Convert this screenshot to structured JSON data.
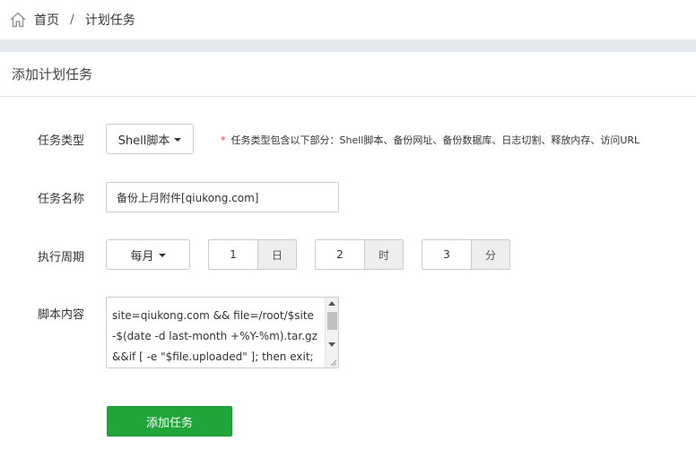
{
  "breadcrumb": {
    "home": "首页",
    "separator": "/",
    "current": "计划任务"
  },
  "panel": {
    "title": "添加计划任务"
  },
  "form": {
    "task_type": {
      "label": "任务类型",
      "selected": "Shell脚本",
      "hint_star": "*",
      "hint": "任务类型包含以下部分：Shell脚本、备份网址、备份数据库、日志切割、释放内存、访问URL"
    },
    "task_name": {
      "label": "任务名称",
      "value": "备份上月附件[qiukong.com]"
    },
    "cycle": {
      "label": "执行周期",
      "period": "每月",
      "day": {
        "value": "1",
        "unit": "日"
      },
      "hour": {
        "value": "2",
        "unit": "时"
      },
      "minute": {
        "value": "3",
        "unit": "分"
      }
    },
    "script": {
      "label": "脚本内容",
      "content": "site=qiukong.com && file=/root/$site-$(date -d last-month +%Y-%m).tar.gz &&if [ -e \"$file.uploaded\" ]; then exit; fi"
    },
    "submit_label": "添加任务"
  },
  "colors": {
    "primary": "#20a53a",
    "band": "#e5e8ec",
    "required": "#ee3333"
  }
}
